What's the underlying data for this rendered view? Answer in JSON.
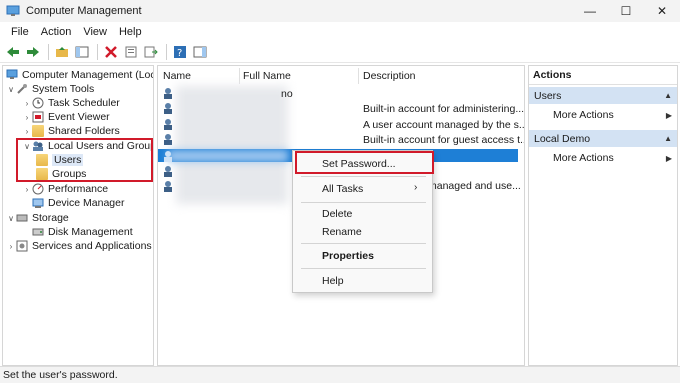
{
  "window": {
    "title": "Computer Management",
    "minimize": "—",
    "maximize": "☐",
    "close": "✕"
  },
  "menu": [
    "File",
    "Action",
    "View",
    "Help"
  ],
  "tree": {
    "root": "Computer Management (Local",
    "system_tools": "System Tools",
    "task_scheduler": "Task Scheduler",
    "event_viewer": "Event Viewer",
    "shared_folders": "Shared Folders",
    "local_users_groups": "Local Users and Groups",
    "users": "Users",
    "groups": "Groups",
    "performance": "Performance",
    "device_manager": "Device Manager",
    "storage": "Storage",
    "disk_management": "Disk Management",
    "services_apps": "Services and Applications"
  },
  "list": {
    "columns": {
      "name": "Name",
      "full_name": "Full Name",
      "description": "Description"
    },
    "descriptions": [
      "Built-in account for administering...",
      "A user account managed by the s...",
      "Built-in account for guest access t...",
      "",
      "managed and use..."
    ],
    "row2_fullname_fragment": "no"
  },
  "context_menu": {
    "set_password": "Set Password...",
    "all_tasks": "All Tasks",
    "delete": "Delete",
    "rename": "Rename",
    "properties": "Properties",
    "help": "Help"
  },
  "actions": {
    "header": "Actions",
    "section1": "Users",
    "section1_more": "More Actions",
    "section2": "Local Demo",
    "section2_more": "More Actions"
  },
  "status": "Set the user's password.",
  "colors": {
    "highlight_red": "#d11a2a",
    "selection_blue": "#1e7fd6",
    "section_blue": "#d3e2f3"
  }
}
